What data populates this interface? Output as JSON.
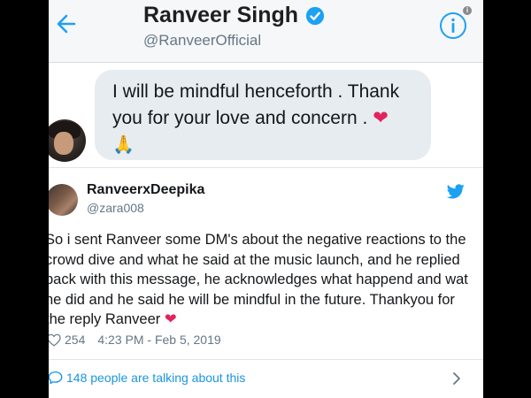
{
  "header": {
    "name": "Ranveer Singh",
    "handle": "@RanveerOfficial",
    "info_badge": "i"
  },
  "dm": {
    "message": "I will be mindful henceforth . Thank you for your love and concern .",
    "heart_emoji": "❤",
    "pray_emoji": "🙏"
  },
  "tweet": {
    "name": "RanveerxDeepika",
    "handle": "@zara008",
    "body": "So i sent Ranveer some DM's about the negative reactions to the crowd dive and what he said at the music launch, and he replied back with this message, he acknowledges what happend and wat he did and he said he will be mindful in the future. Thankyou for the reply Ranveer",
    "heart_emoji": "❤",
    "likes": "254",
    "timestamp": "4:23 PM - Feb 5, 2019"
  },
  "footer": {
    "talking_text": "148 people are talking about this"
  },
  "icons": {
    "back": "arrow-left-icon",
    "verified": "verified-badge-icon",
    "info": "info-icon",
    "twitter": "twitter-bird-icon",
    "like": "heart-outline-icon",
    "talk": "speech-bubble-icon",
    "chevron": "chevron-right-icon"
  },
  "colors": {
    "twitter_blue": "#1da1f2",
    "link_blue": "#1b95e0",
    "heart_red": "#e0245e",
    "bubble_bg": "#e6ecf0",
    "header_bg": "#f6f7f8"
  }
}
